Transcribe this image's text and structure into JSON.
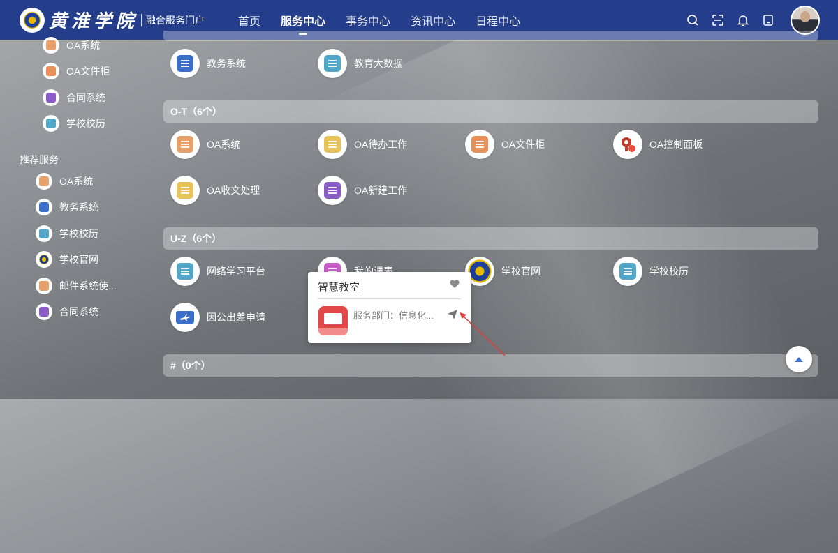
{
  "header": {
    "logo_text": "黄淮学院",
    "portal_label": "融合服务门户",
    "nav": [
      {
        "label": "首页",
        "active": false
      },
      {
        "label": "服务中心",
        "active": true
      },
      {
        "label": "事务中心",
        "active": false
      },
      {
        "label": "资讯中心",
        "active": false
      },
      {
        "label": "日程中心",
        "active": false
      }
    ],
    "icons": [
      "search-icon",
      "scan-icon",
      "bell-icon",
      "tablet-icon"
    ]
  },
  "sidebar": {
    "top_items": [
      {
        "label": "OA系统",
        "icon": "oa-system-icon"
      },
      {
        "label": "OA文件柜",
        "icon": "oa-folder-icon"
      },
      {
        "label": "合同系统",
        "icon": "contract-icon"
      },
      {
        "label": "学校校历",
        "icon": "calendar-icon"
      }
    ],
    "recommended_title": "推荐服务",
    "recommended_items": [
      {
        "label": "OA系统",
        "icon": "oa-system-icon"
      },
      {
        "label": "教务系统",
        "icon": "academic-icon"
      },
      {
        "label": "学校校历",
        "icon": "calendar-icon"
      },
      {
        "label": "学校官网",
        "icon": "school-seal-icon"
      },
      {
        "label": "邮件系统使...",
        "icon": "mail-icon"
      },
      {
        "label": "合同系统",
        "icon": "contract-icon"
      }
    ]
  },
  "main": {
    "group_prev_apps": [
      {
        "label": "教务系统",
        "icon": "academic-icon"
      },
      {
        "label": "教育大数据",
        "icon": "user-data-icon"
      }
    ],
    "section_ot": {
      "title": "O-T（6个）",
      "apps": [
        {
          "label": "OA系统"
        },
        {
          "label": "OA待办工作"
        },
        {
          "label": "OA文件柜"
        },
        {
          "label": "OA控制面板"
        },
        {
          "label": "OA收文处理"
        },
        {
          "label": "OA新建工作"
        }
      ]
    },
    "section_uz": {
      "title": "U-Z（6个）",
      "apps": [
        {
          "label": "网络学习平台"
        },
        {
          "label": "我的课表"
        },
        {
          "label": "学校官网"
        },
        {
          "label": "学校校历"
        },
        {
          "label": "因公出差申请"
        }
      ]
    },
    "section_hash": {
      "title": "#（0个）"
    }
  },
  "popup": {
    "title": "智慧教室",
    "department": "服务部门：信息化..."
  },
  "colors": {
    "header_bg": "#243e8c",
    "orange": "#e8a06a",
    "yellow": "#e8c25a",
    "purple": "#8a5cc7",
    "blue": "#3c6fc9",
    "teal": "#52a7c9",
    "red": "#c0392b",
    "popup_icon": "#e34848"
  }
}
